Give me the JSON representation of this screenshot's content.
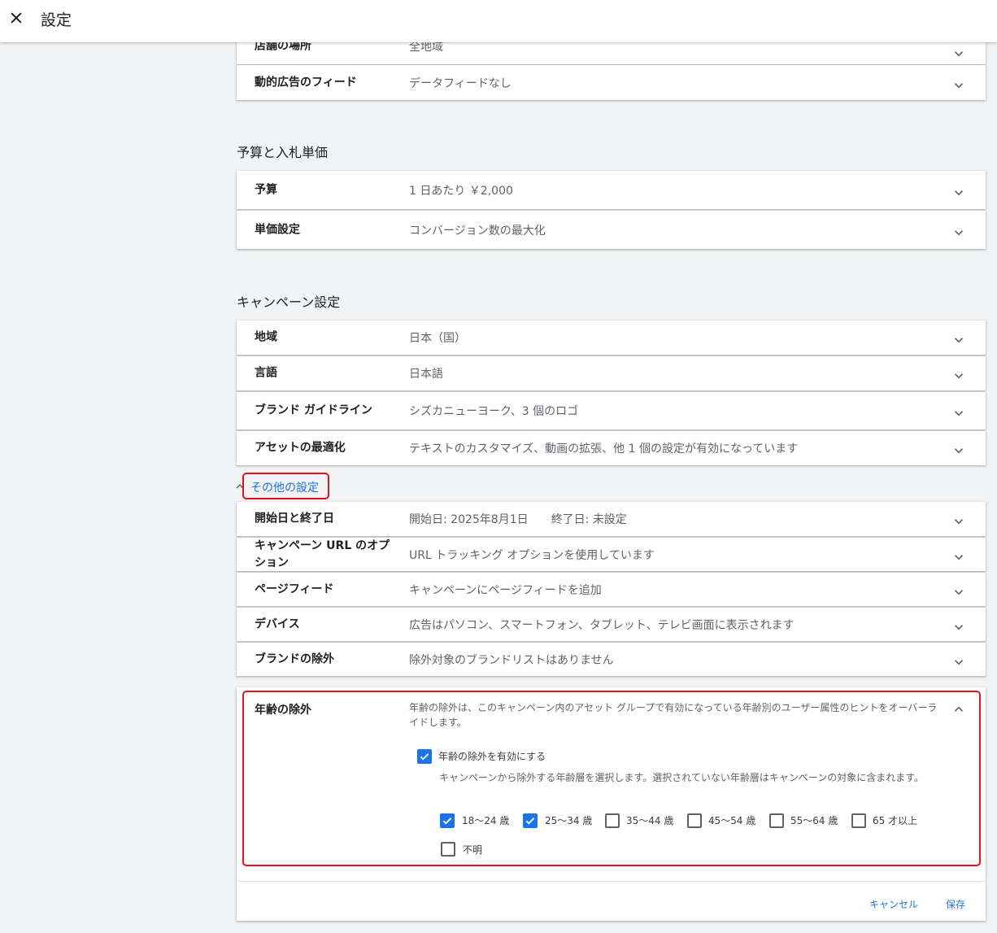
{
  "header": {
    "title": "設定"
  },
  "top_rows": [
    {
      "label": "店舗の場所",
      "value": "全地域"
    },
    {
      "label": "動的広告のフィード",
      "value": "データフィードなし"
    }
  ],
  "budget_section": {
    "title": "予算と入札単価",
    "rows": [
      {
        "label": "予算",
        "value": "1 日あたり ￥2,000"
      },
      {
        "label": "単価設定",
        "value": "コンバージョン数の最大化"
      }
    ]
  },
  "campaign_section": {
    "title": "キャンペーン設定",
    "rows": [
      {
        "label": "地域",
        "value": "日本（国）"
      },
      {
        "label": "言語",
        "value": "日本語"
      },
      {
        "label": "ブランド ガイドライン",
        "value": "シズカニューヨーク、3 個のロゴ"
      },
      {
        "label": "アセットの最適化",
        "value": "テキストのカスタマイズ、動画の拡張、他 1 個の設定が有効になっています"
      }
    ]
  },
  "more_settings": {
    "label": "その他の設定",
    "rows": [
      {
        "label": "開始日と終了日",
        "value": "開始日: 2025年8月1日　　終了日: 未設定"
      },
      {
        "label": "キャンペーン URL のオプション",
        "value": "URL トラッキング オプションを使用しています"
      },
      {
        "label": "ページフィード",
        "value": "キャンペーンにページフィードを追加"
      },
      {
        "label": "デバイス",
        "value": "広告はパソコン、スマートフォン、タブレット、テレビ画面に表示されます"
      },
      {
        "label": "ブランドの除外",
        "value": "除外対象のブランドリストはありません"
      }
    ]
  },
  "age_exclusion": {
    "label": "年齢の除外",
    "description": "年齢の除外は、このキャンペーン内のアセット グループで有効になっている年齢別のユーザー属性のヒントをオーバーライドします。",
    "enable_label": "年齢の除外を有効にする",
    "enable_checked": true,
    "select_description": "キャンペーンから除外する年齢層を選択します。選択されていない年齢層はキャンペーンの対象に含まれます。",
    "options": [
      {
        "label": "18〜24 歳",
        "checked": true
      },
      {
        "label": "25〜34 歳",
        "checked": true
      },
      {
        "label": "35〜44 歳",
        "checked": false
      },
      {
        "label": "45〜54 歳",
        "checked": false
      },
      {
        "label": "55〜64 歳",
        "checked": false
      },
      {
        "label": "65 才以上",
        "checked": false
      },
      {
        "label": "不明",
        "checked": false
      }
    ],
    "cancel_label": "キャンセル",
    "save_label": "保存"
  },
  "colors": {
    "accent": "#1a73e8",
    "highlight": "#e3111b",
    "background": "#f1f3f4"
  }
}
